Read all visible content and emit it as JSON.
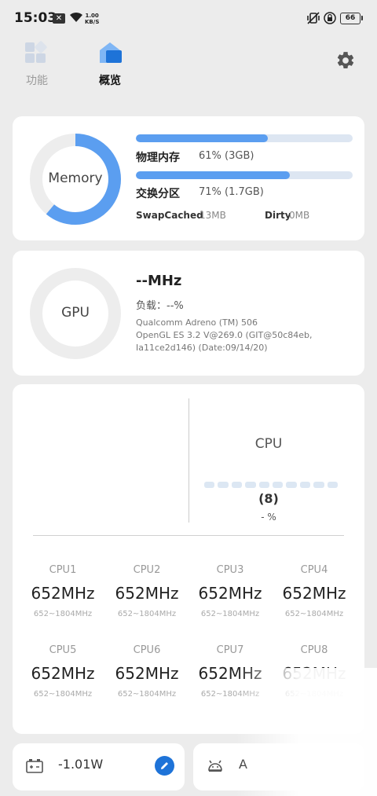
{
  "status_bar": {
    "time": "15:03",
    "net_speed_value": "1.00",
    "net_speed_unit": "KB/S",
    "battery": "66"
  },
  "nav": {
    "tabs": [
      {
        "label": "功能"
      },
      {
        "label": "概览"
      }
    ]
  },
  "memory": {
    "ring_label": "Memory",
    "ring_fraction": 0.61,
    "physical": {
      "label": "物理内存",
      "value": "61% (3GB)",
      "fraction": 0.61
    },
    "swap": {
      "label": "交换分区",
      "value": "71% (1.7GB)",
      "fraction": 0.71
    },
    "swap_cached_label": "SwapCached",
    "swap_cached_value": "13MB",
    "dirty_label": "Dirty",
    "dirty_value": "0MB"
  },
  "gpu": {
    "ring_label": "GPU",
    "freq": "--MHz",
    "load": "负载：--%",
    "renderer": "Qualcomm Adreno (TM) 506",
    "gl_version": "OpenGL ES 3.2 V@269.0 (GIT@50c84eb,",
    "gl_build": "Ia11ce2d146) (Date:09/14/20)"
  },
  "cpu": {
    "title": "CPU",
    "core_count": "(8)",
    "load": "- %",
    "cores": [
      {
        "name": "CPU1",
        "freq": "652MHz",
        "range": "652~1804MHz"
      },
      {
        "name": "CPU2",
        "freq": "652MHz",
        "range": "652~1804MHz"
      },
      {
        "name": "CPU3",
        "freq": "652MHz",
        "range": "652~1804MHz"
      },
      {
        "name": "CPU4",
        "freq": "652MHz",
        "range": "652~1804MHz"
      },
      {
        "name": "CPU5",
        "freq": "652MHz",
        "range": "652~1804MHz"
      },
      {
        "name": "CPU6",
        "freq": "652MHz",
        "range": "652~1804MHz"
      },
      {
        "name": "CPU7",
        "freq": "652MHz",
        "range": "652~1804MHz"
      },
      {
        "name": "CPU8",
        "freq": "652MHz",
        "range": "652~1804MHz"
      }
    ]
  },
  "power": {
    "value": "-1.01W"
  },
  "android": {
    "value": "A"
  },
  "colors": {
    "accent": "#5b9ef0",
    "track": "#dde6f2",
    "ring_track": "#ededed",
    "edit_button": "#1e73d8"
  },
  "icons": [
    "wifi-icon",
    "vibrate-icon",
    "lock-icon",
    "grid-icon",
    "home-icon",
    "gear-icon",
    "battery-icon",
    "pencil-icon",
    "android-icon"
  ]
}
